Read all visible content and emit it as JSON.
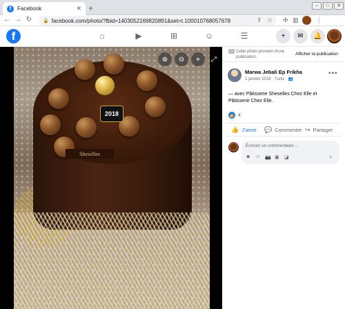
{
  "browser": {
    "tab_title": "Facebook",
    "favicon_letter": "f",
    "new_tab": "+",
    "url": "facebook.com/photo/?fbid=1403052169820891&set=t.100010768057678"
  },
  "fb_header": {
    "logo_letter": "f"
  },
  "photo": {
    "topper_text": "2018",
    "plaque_text": "Sheselles"
  },
  "side": {
    "notice_text": "Cette photo provient d'une publication.",
    "show_button": "Afficher la publication",
    "author_name": "Marwa Jebali Ep Frikha",
    "post_date": "1 janvier 2018 · Tunis · ",
    "post_text": "— avec Pâtisserie Sheselles Chez Elle et Pâtisserie Chez Elle.",
    "like_count": "4",
    "actions": {
      "like": "J'aime",
      "comment": "Commenter",
      "share": "Partager"
    },
    "comment_placeholder": "Écrivez un commentaire…"
  },
  "colors": {
    "brand": "#1877f2",
    "secondary_text": "#65676b"
  }
}
